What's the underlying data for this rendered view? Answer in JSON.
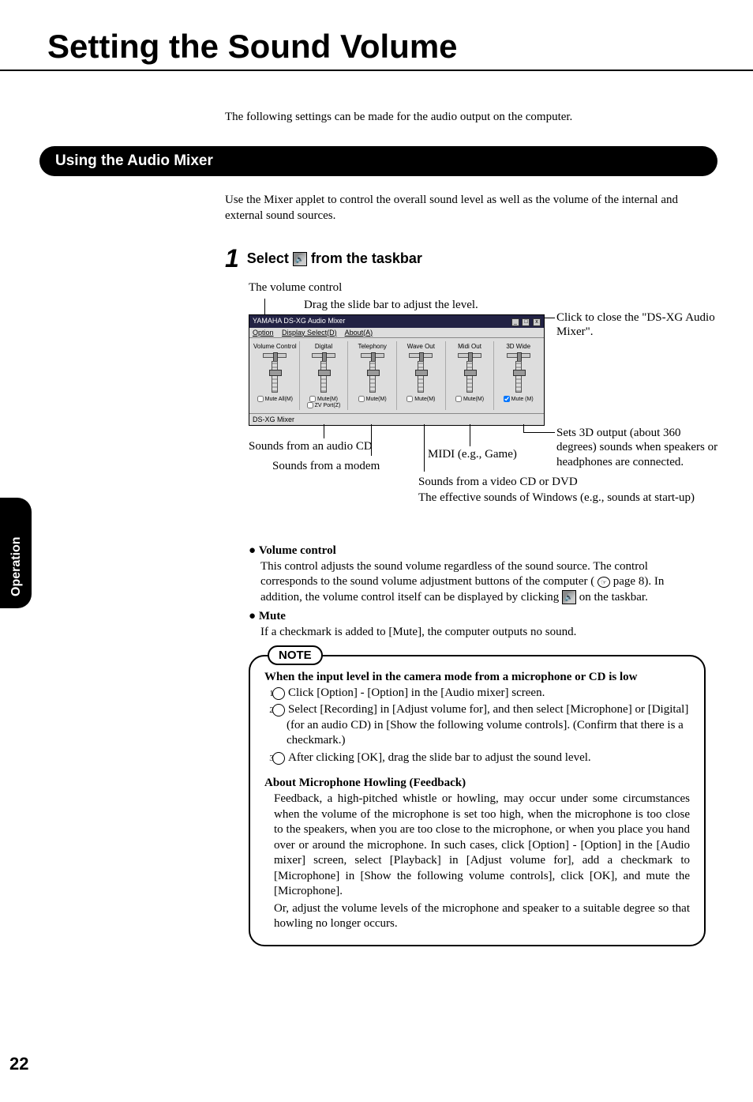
{
  "page_title": "Setting the Sound Volume",
  "intro": "The following settings can be made for the audio output on the computer.",
  "section_header": "Using the Audio Mixer",
  "section_intro": "Use the Mixer applet to control the overall sound level as well as the volume of the internal and external sound sources.",
  "step": {
    "num": "1",
    "prefix": "Select ",
    "suffix": " from the taskbar"
  },
  "diagram": {
    "volume_control_label": "The volume control",
    "drag_label": "Drag the slide bar to adjust the level.",
    "close_callout": "Click to close the \"DS-XG Audio Mixer\".",
    "cd_callout": "Sounds from an audio CD",
    "modem_callout": "Sounds from a modem",
    "midi_callout": "MIDI (e.g., Game)",
    "video_callout": "Sounds from a video CD or DVD",
    "effective_callout": "The effective sounds of Windows (e.g., sounds at start-up)",
    "threed_callout": "Sets 3D output (about 360 degrees) sounds when speakers or headphones are connected."
  },
  "mixer": {
    "title": "YAMAHA DS-XG Audio Mixer",
    "menu": [
      "Option",
      "Display Select(D)",
      "About(A)"
    ],
    "channels": [
      {
        "name": "Volume Control",
        "mute": "Mute All(M)"
      },
      {
        "name": "Digital",
        "mute": "Mute(M)",
        "extra": "ZV Port(Z)"
      },
      {
        "name": "Telephony",
        "mute": "Mute(M)"
      },
      {
        "name": "Wave Out",
        "mute": "Mute(M)"
      },
      {
        "name": "Midi Out",
        "mute": "Mute(M)"
      },
      {
        "name": "3D Wide",
        "mute": "Mute (M)"
      }
    ],
    "status": "DS-XG Mixer"
  },
  "bullets": {
    "vol_head": "Volume control",
    "vol_body_1": "This control adjusts the sound volume regardless of the sound source.  The control corresponds to the sound volume adjustment buttons of the computer (",
    "vol_body_2": " page 8).  In addition, the volume control itself can be displayed by clicking ",
    "vol_body_3": " on the taskbar.",
    "mute_head": "Mute",
    "mute_body": "If a checkmark is added to [Mute], the computer outputs no sound."
  },
  "note": {
    "tab": "NOTE",
    "head": "When the input level in the camera mode from a microphone or CD is low",
    "items": [
      "Click [Option] - [Option] in the [Audio mixer] screen.",
      "Select [Recording] in [Adjust volume for], and then select [Microphone] or [Digital] (for an audio CD) in [Show the following volume controls].  (Confirm that there is a checkmark.)",
      "After clicking [OK], drag the slide bar to adjust the sound level."
    ],
    "about_head": "About Microphone Howling (Feedback)",
    "about_body_1": "Feedback, a high-pitched whistle or howling, may occur under some circumstances when the volume of the microphone is set too high, when the microphone is too close to the speakers, when you are too close to the microphone, or when you place you hand over or around the microphone. In such cases, click [Option] - [Option] in the [Audio mixer] screen, select [Playback] in [Adjust volume for], add a checkmark to [Microphone] in [Show the following volume controls], click [OK], and mute the [Microphone].",
    "about_body_2": "Or, adjust the volume levels of the microphone and speaker to a suitable degree so that howling no longer occurs."
  },
  "side_tab": "Operation",
  "page_num": "22"
}
